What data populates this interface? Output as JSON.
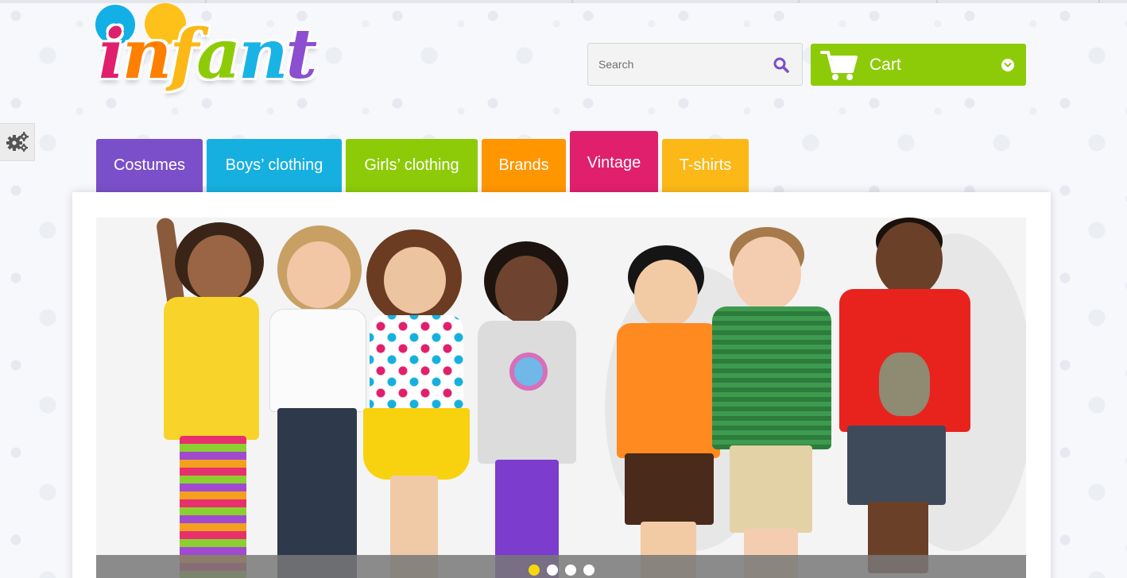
{
  "logo": {
    "text": "infant",
    "alt": "infant"
  },
  "search": {
    "placeholder": "Search"
  },
  "cart": {
    "label": "Cart"
  },
  "nav": {
    "tabs": [
      {
        "label": "Costumes",
        "color": "#7b4fc9"
      },
      {
        "label": "Boys’ clothing",
        "color": "#16b0e0"
      },
      {
        "label": "Girls’ clothing",
        "color": "#8dcb08"
      },
      {
        "label": "Brands",
        "color": "#ff9600"
      },
      {
        "label": "Vintage",
        "color": "#e0206c",
        "active": true
      },
      {
        "label": "T-shirts",
        "color": "#fcb817"
      }
    ]
  },
  "slider": {
    "dots": 4,
    "active_dot": 1
  },
  "colors": {
    "accent_green": "#8dcb08",
    "search_icon": "#7b4fc9",
    "dot_active": "#f8d80c"
  }
}
